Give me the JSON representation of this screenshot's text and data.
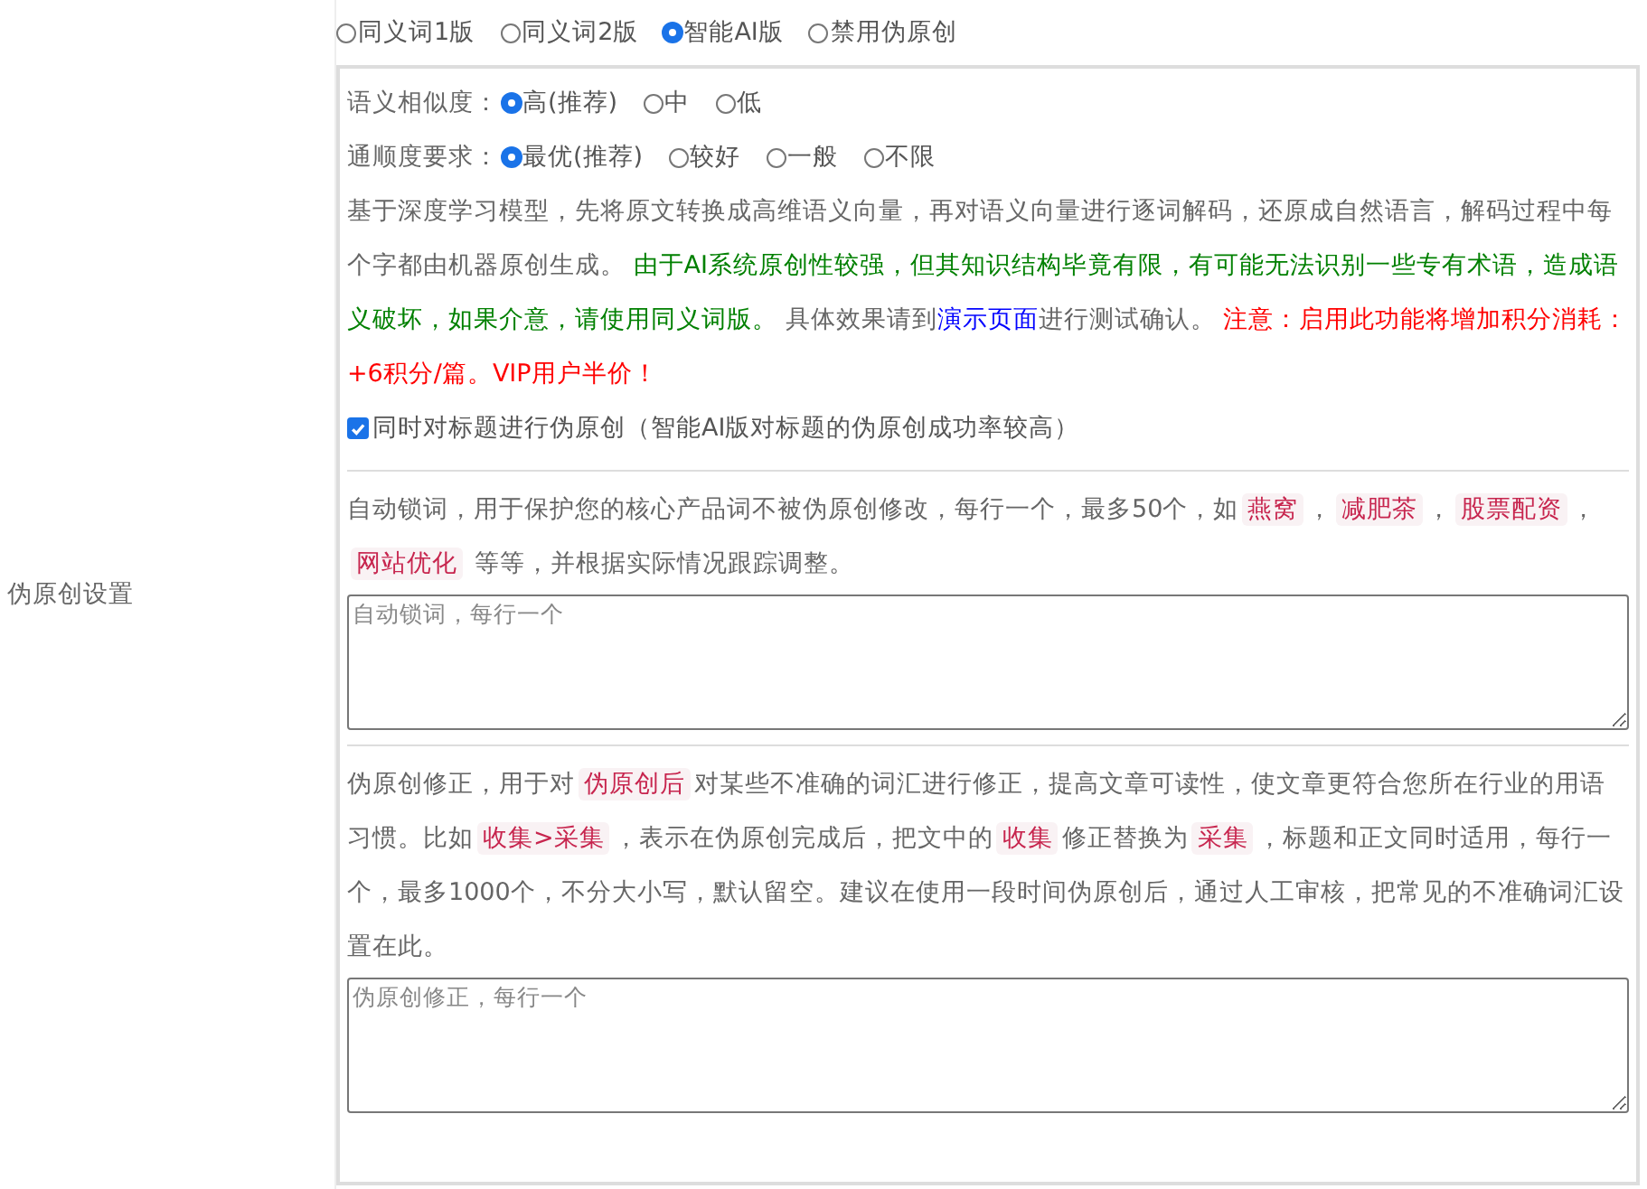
{
  "section_label": "伪原创设置",
  "modes": [
    {
      "label": "同义词1版",
      "selected": false
    },
    {
      "label": "同义词2版",
      "selected": false
    },
    {
      "label": "智能AI版",
      "selected": true
    },
    {
      "label": "禁用伪原创",
      "selected": false
    }
  ],
  "option_groups": [
    {
      "label": "语义相似度：",
      "options": [
        {
          "label": "高(推荐)",
          "selected": true
        },
        {
          "label": "中",
          "selected": false
        },
        {
          "label": "低",
          "selected": false
        }
      ]
    },
    {
      "label": "通顺度要求：",
      "options": [
        {
          "label": "最优(推荐)",
          "selected": true
        },
        {
          "label": "较好",
          "selected": false
        },
        {
          "label": "一般",
          "selected": false
        },
        {
          "label": "不限",
          "selected": false
        }
      ]
    }
  ],
  "description": [
    {
      "kind": "text",
      "text": "基于深度学习模型，先将原文转换成高维语义向量，再对语义向量进行逐词解码，还原成自然语言，解码过程中每个字都由机器原创生成。 "
    },
    {
      "kind": "note",
      "text": "由于AI系统原创性较强，但其知识结构毕竟有限，有可能无法识别一些专有术语，造成语义破坏，如果介意，请使用同义词版。"
    },
    {
      "kind": "text",
      "text": " 具体效果请到"
    },
    {
      "kind": "link",
      "text": "演示页面"
    },
    {
      "kind": "text",
      "text": "进行测试确认。 "
    },
    {
      "kind": "warning",
      "text": "注意：启用此功能将增加积分消耗：+6积分/篇。VIP用户半价！"
    }
  ],
  "title_option": {
    "label": "同时对标题进行伪原创（智能AI版对标题的伪原创成功率较高）",
    "checked": true
  },
  "lock_words": {
    "description": [
      {
        "kind": "text",
        "text": "自动锁词，用于保护您的核心产品词不被伪原创修改，每行一个，最多50个，如"
      },
      {
        "kind": "code",
        "text": "燕窝"
      },
      {
        "kind": "text",
        "text": "，"
      },
      {
        "kind": "code",
        "text": "减肥茶"
      },
      {
        "kind": "text",
        "text": "，"
      },
      {
        "kind": "code",
        "text": "股票配资"
      },
      {
        "kind": "text",
        "text": "，"
      },
      {
        "kind": "code",
        "text": "网站优化"
      },
      {
        "kind": "text",
        "text": " 等等，并根据实际情况跟踪调整。"
      }
    ],
    "placeholder": "自动锁词，每行一个"
  },
  "correction": {
    "description": [
      {
        "kind": "text",
        "text": "伪原创修正，用于对"
      },
      {
        "kind": "code",
        "text": "伪原创后"
      },
      {
        "kind": "text",
        "text": "对某些不准确的词汇进行修正，提高文章可读性，使文章更符合您所在行业的用语习惯。比如"
      },
      {
        "kind": "code",
        "text": "收集>采集"
      },
      {
        "kind": "text",
        "text": "，表示在伪原创完成后，把文中的"
      },
      {
        "kind": "code",
        "text": "收集"
      },
      {
        "kind": "text",
        "text": "修正替换为"
      },
      {
        "kind": "code",
        "text": "采集"
      },
      {
        "kind": "text",
        "text": "，标题和正文同时适用，每行一个，最多1000个，不分大小写，默认留空。建议在使用一段时间伪原创后，通过人工审核，把常见的不准确词汇设置在此。"
      }
    ],
    "placeholder": "伪原创修正，每行一个"
  }
}
